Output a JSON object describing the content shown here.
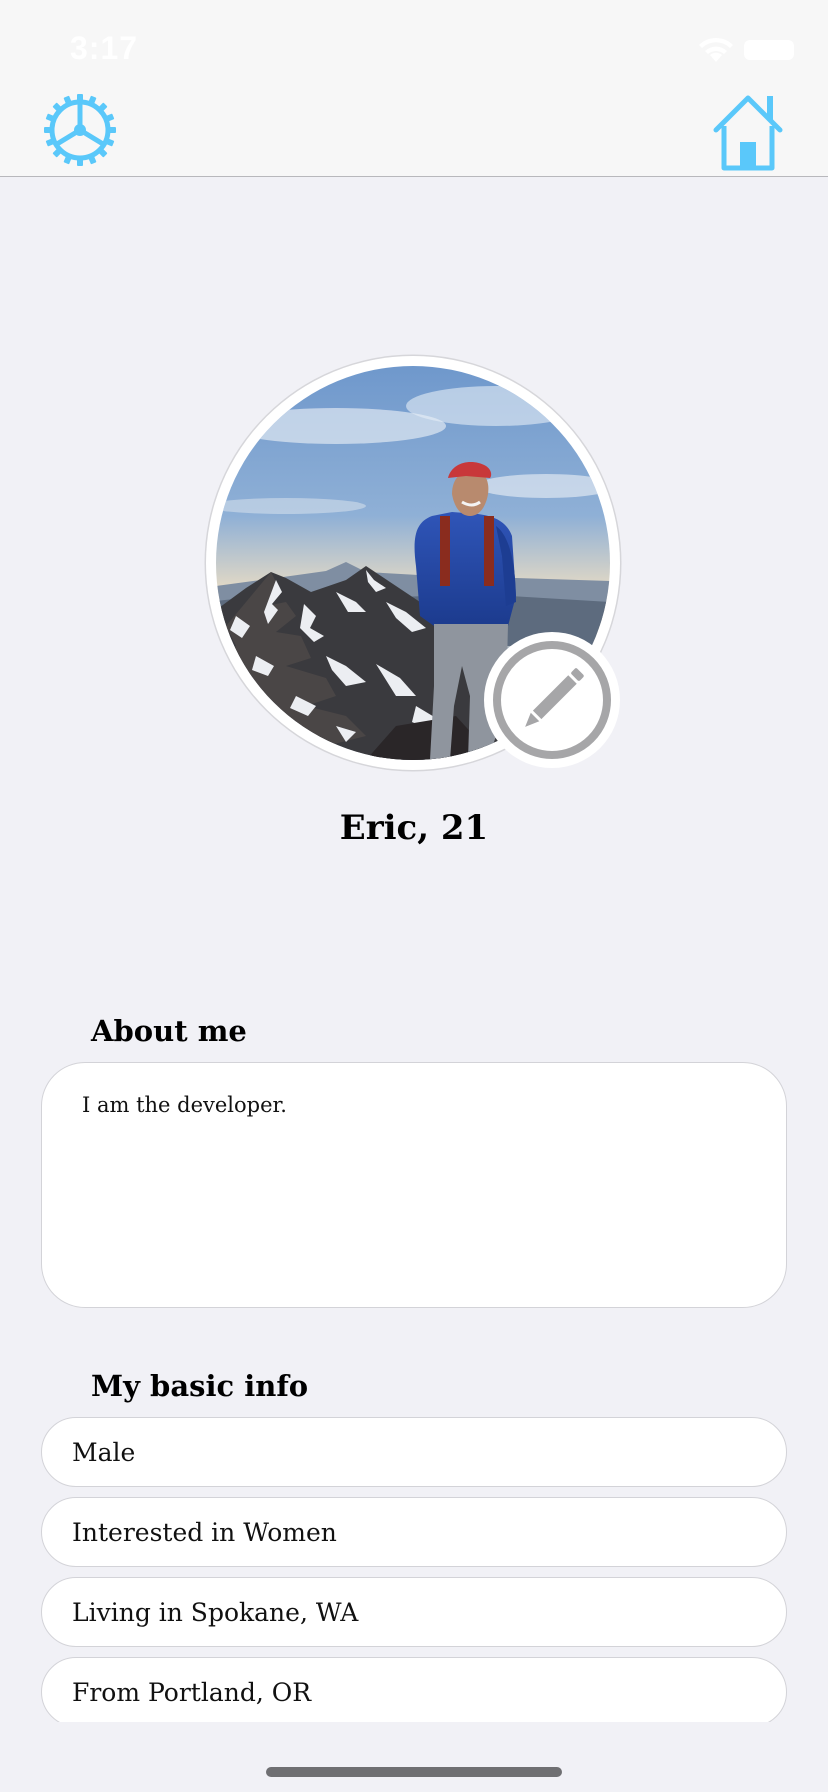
{
  "status_bar": {
    "time": "3:17"
  },
  "nav": {
    "settings_icon": "gear-icon",
    "home_icon": "house-icon",
    "accent_color": "#5ac8fa"
  },
  "profile": {
    "name_age": "Eric, 21",
    "photo": "mountain-summit-photo",
    "edit_icon": "pencil-icon"
  },
  "about": {
    "heading": "About me",
    "text": "I am the developer."
  },
  "basic_info": {
    "heading": "My basic info",
    "items": [
      "Male",
      "Interested in Women",
      "Living in Spokane, WA",
      "From Portland, OR"
    ]
  }
}
